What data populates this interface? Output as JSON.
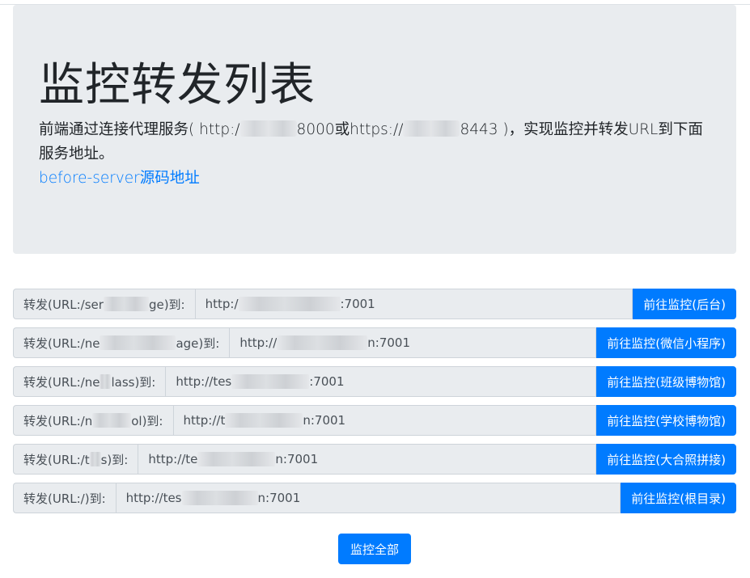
{
  "header": {
    "title": "监控转发列表",
    "lead": {
      "part1": "前端通过连接代理服务( http:/",
      "part2": "8000或https://",
      "part3": "8443 )，实现监控并转发URL到下面服务地址。"
    },
    "source_link": "before-server源码地址"
  },
  "routes": [
    {
      "prefix_start": "转发(URL:/ser",
      "prefix_end": "ge)到:",
      "url_start": "http:/",
      "url_end": ":7001",
      "button": "前往监控(后台)"
    },
    {
      "prefix_start": "转发(URL:/ne",
      "prefix_end": "age)到:",
      "url_start": "http://",
      "url_end": "n:7001",
      "button": "前往监控(微信小程序)"
    },
    {
      "prefix_start": "转发(URL:/ne",
      "prefix_end": "lass)到:",
      "url_start": "http://tes",
      "url_end": ":7001",
      "button": "前往监控(班级博物馆)"
    },
    {
      "prefix_start": "转发(URL:/n",
      "prefix_end": "ol)到:",
      "url_start": "http://t",
      "url_end": "n:7001",
      "button": "前往监控(学校博物馆)"
    },
    {
      "prefix_start": "转发(URL:/t",
      "prefix_end": "s)到:",
      "url_start": "http://te",
      "url_end": "n:7001",
      "button": "前往监控(大合照拼接)"
    },
    {
      "prefix_start": "转发(URL:/)到:",
      "prefix_end": "",
      "url_start": "http://tes",
      "url_end": "n:7001",
      "button": "前往监控(根目录)"
    }
  ],
  "footer": {
    "monitor_all_button": "监控全部"
  },
  "colors": {
    "primary": "#007bff",
    "jumbotron_bg": "#e9ecef"
  }
}
